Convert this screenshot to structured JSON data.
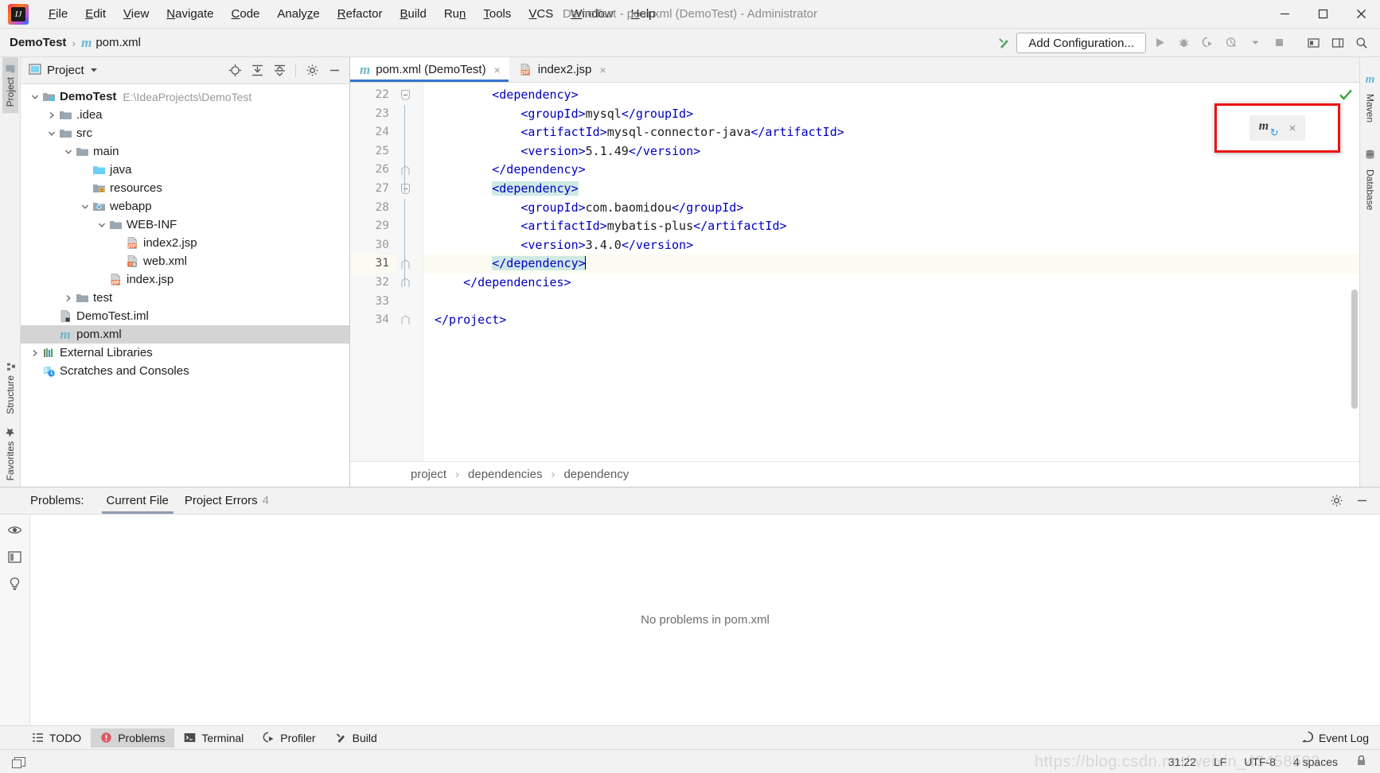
{
  "window": {
    "title": "DemoTest - pom.xml (DemoTest) - Administrator",
    "minimize": "–",
    "maximize": "□",
    "close": "×"
  },
  "menubar": [
    {
      "label": "File",
      "mnemonic": "F"
    },
    {
      "label": "Edit",
      "mnemonic": "E"
    },
    {
      "label": "View",
      "mnemonic": "V"
    },
    {
      "label": "Navigate",
      "mnemonic": "N"
    },
    {
      "label": "Code",
      "mnemonic": "C"
    },
    {
      "label": "Analyze",
      "mnemonic": "z"
    },
    {
      "label": "Refactor",
      "mnemonic": "R"
    },
    {
      "label": "Build",
      "mnemonic": "B"
    },
    {
      "label": "Run",
      "mnemonic": "n"
    },
    {
      "label": "Tools",
      "mnemonic": "T"
    },
    {
      "label": "VCS",
      "mnemonic": "V"
    },
    {
      "label": "Window",
      "mnemonic": "W"
    },
    {
      "label": "Help",
      "mnemonic": "H"
    }
  ],
  "navbar": {
    "project": "DemoTest",
    "separator": "›",
    "file": "pom.xml",
    "file_icon_letter": "m",
    "add_configuration": "Add Configuration..."
  },
  "left_rail": {
    "project_tab": "Project",
    "structure_tab": "Structure",
    "favorites_tab": "Favorites"
  },
  "right_rail": {
    "maven_tab": "Maven",
    "database_tab": "Database",
    "maven_icon_letter": "m"
  },
  "project_panel": {
    "title": "Project",
    "tree": [
      {
        "depth": 0,
        "twist": "v",
        "icon": "module-folder",
        "label": "DemoTest",
        "bold": true,
        "path": "E:\\IdeaProjects\\DemoTest",
        "selected": false
      },
      {
        "depth": 1,
        "twist": ">",
        "icon": "folder",
        "label": ".idea",
        "bold": false,
        "path": "",
        "selected": false
      },
      {
        "depth": 1,
        "twist": "v",
        "icon": "folder",
        "label": "src",
        "bold": false,
        "path": "",
        "selected": false
      },
      {
        "depth": 2,
        "twist": "v",
        "icon": "folder",
        "label": "main",
        "bold": false,
        "path": "",
        "selected": false
      },
      {
        "depth": 3,
        "twist": "",
        "icon": "source-folder",
        "label": "java",
        "bold": false,
        "path": "",
        "selected": false
      },
      {
        "depth": 3,
        "twist": "",
        "icon": "resources-folder",
        "label": "resources",
        "bold": false,
        "path": "",
        "selected": false
      },
      {
        "depth": 3,
        "twist": "v",
        "icon": "webapp-folder",
        "label": "webapp",
        "bold": false,
        "path": "",
        "selected": false
      },
      {
        "depth": 4,
        "twist": "v",
        "icon": "folder",
        "label": "WEB-INF",
        "bold": false,
        "path": "",
        "selected": false
      },
      {
        "depth": 5,
        "twist": "",
        "icon": "jsp-file",
        "label": "index2.jsp",
        "bold": false,
        "path": "",
        "selected": false
      },
      {
        "depth": 5,
        "twist": "",
        "icon": "xml-file",
        "label": "web.xml",
        "bold": false,
        "path": "",
        "selected": false
      },
      {
        "depth": 4,
        "twist": "",
        "icon": "jsp-file",
        "label": "index.jsp",
        "bold": false,
        "path": "",
        "selected": false
      },
      {
        "depth": 2,
        "twist": ">",
        "icon": "folder",
        "label": "test",
        "bold": false,
        "path": "",
        "selected": false
      },
      {
        "depth": 1,
        "twist": "",
        "icon": "iml-file",
        "label": "DemoTest.iml",
        "bold": false,
        "path": "",
        "selected": false
      },
      {
        "depth": 1,
        "twist": "",
        "icon": "maven-file",
        "label": "pom.xml",
        "bold": false,
        "path": "",
        "selected": true
      },
      {
        "depth": 0,
        "twist": ">",
        "icon": "libraries",
        "label": "External Libraries",
        "bold": false,
        "path": "",
        "selected": false
      },
      {
        "depth": 0,
        "twist": "",
        "icon": "scratches",
        "label": "Scratches and Consoles",
        "bold": false,
        "path": "",
        "selected": false
      }
    ]
  },
  "editor": {
    "tabs": [
      {
        "label": "pom.xml (DemoTest)",
        "icon": "maven-file",
        "active": true,
        "close": "×"
      },
      {
        "label": "index2.jsp",
        "icon": "jsp-file",
        "active": false,
        "close": "×"
      }
    ],
    "first_line_number": 22,
    "current_line": 31,
    "lines": [
      {
        "n": 22,
        "indent": 8,
        "fold": "minus",
        "tokens": [
          {
            "t": "<dependency>",
            "c": "tag"
          }
        ]
      },
      {
        "n": 23,
        "indent": 12,
        "fold": "",
        "tokens": [
          {
            "t": "<groupId>",
            "c": "tag"
          },
          {
            "t": "mysql",
            "c": "text"
          },
          {
            "t": "</groupId>",
            "c": "tag"
          }
        ]
      },
      {
        "n": 24,
        "indent": 12,
        "fold": "",
        "tokens": [
          {
            "t": "<artifactId>",
            "c": "tag"
          },
          {
            "t": "mysql-connector-java",
            "c": "text"
          },
          {
            "t": "</artifactId>",
            "c": "tag"
          }
        ]
      },
      {
        "n": 25,
        "indent": 12,
        "fold": "",
        "tokens": [
          {
            "t": "<version>",
            "c": "tag"
          },
          {
            "t": "5.1.49",
            "c": "text"
          },
          {
            "t": "</version>",
            "c": "tag"
          }
        ]
      },
      {
        "n": 26,
        "indent": 8,
        "fold": "end",
        "tokens": [
          {
            "t": "</dependency>",
            "c": "tag"
          }
        ]
      },
      {
        "n": 27,
        "indent": 8,
        "fold": "minus",
        "tokens": [
          {
            "t": "<dependency>",
            "c": "tag-hl"
          }
        ]
      },
      {
        "n": 28,
        "indent": 12,
        "fold": "",
        "tokens": [
          {
            "t": "<groupId>",
            "c": "tag"
          },
          {
            "t": "com.baomidou",
            "c": "text"
          },
          {
            "t": "</groupId>",
            "c": "tag"
          }
        ]
      },
      {
        "n": 29,
        "indent": 12,
        "fold": "",
        "tokens": [
          {
            "t": "<artifactId>",
            "c": "tag"
          },
          {
            "t": "mybatis-plus",
            "c": "text"
          },
          {
            "t": "</artifactId>",
            "c": "tag"
          }
        ]
      },
      {
        "n": 30,
        "indent": 12,
        "fold": "",
        "tokens": [
          {
            "t": "<version>",
            "c": "tag"
          },
          {
            "t": "3.4.0",
            "c": "text"
          },
          {
            "t": "</version>",
            "c": "tag"
          }
        ]
      },
      {
        "n": 31,
        "indent": 8,
        "fold": "end",
        "tokens": [
          {
            "t": "</dependency>",
            "c": "tag-hl"
          }
        ],
        "caret": true
      },
      {
        "n": 32,
        "indent": 4,
        "fold": "end",
        "tokens": [
          {
            "t": "</dependencies>",
            "c": "tag"
          }
        ]
      },
      {
        "n": 33,
        "indent": 0,
        "fold": "",
        "tokens": []
      },
      {
        "n": 34,
        "indent": 0,
        "fold": "end",
        "tokens": [
          {
            "t": "</project>",
            "c": "tag"
          }
        ]
      }
    ],
    "breadcrumbs": [
      "project",
      "dependencies",
      "dependency"
    ],
    "breadcrumb_separator": "›"
  },
  "maven_popup": {
    "icon_letter": "m",
    "refresh_glyph": "↻",
    "close_glyph": "×",
    "border_color": "#ee1111"
  },
  "problems_panel": {
    "label": "Problems:",
    "tabs": [
      {
        "label": "Current File",
        "count": "",
        "active": true
      },
      {
        "label": "Project Errors",
        "count": "4",
        "active": false
      }
    ],
    "empty_message": "No problems in pom.xml"
  },
  "toolwindow_bar": {
    "items": [
      {
        "label": "TODO",
        "icon": "todo-icon",
        "active": false
      },
      {
        "label": "Problems",
        "icon": "problems-icon",
        "active": true
      },
      {
        "label": "Terminal",
        "icon": "terminal-icon",
        "active": false
      },
      {
        "label": "Profiler",
        "icon": "profiler-icon",
        "active": false
      },
      {
        "label": "Build",
        "icon": "build-icon",
        "active": false
      }
    ],
    "event_log": "Event Log"
  },
  "statusbar": {
    "caret_position": "31:22",
    "line_separator": "LF",
    "encoding": "UTF-8",
    "indent": "4 spaces",
    "watermark": "https://blog.csdn.net/weixin_43458592"
  },
  "colors": {
    "accent": "#3376cd",
    "tag": "#0000c0",
    "tag_name": "#3f7f7f",
    "highlight": "#cfeae5",
    "selection": "#d4d4d4",
    "error": "#ee1111",
    "ok": "#3a9e3a"
  }
}
